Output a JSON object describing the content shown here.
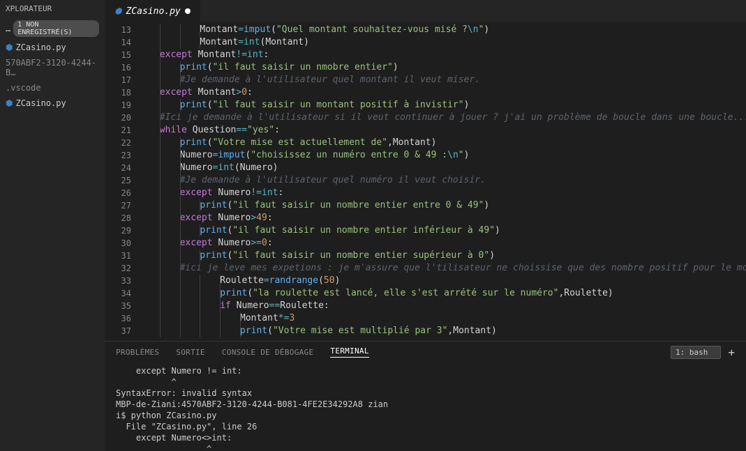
{
  "sidebar": {
    "header": "XPLORATEUR",
    "unsavedLabel": "1 NON ENREGISTRÉ(S)",
    "unsavedRow": "…",
    "items": [
      {
        "label": "ZCasino.py",
        "icon": "py"
      },
      {
        "label": "570ABF2-3120-4244-B…",
        "icon": ""
      },
      {
        "label": ".vscode",
        "icon": ""
      },
      {
        "label": "ZCasino.py",
        "icon": "py"
      }
    ]
  },
  "tab": {
    "file": "ZCasino.py"
  },
  "code": {
    "start": 13,
    "lines": [
      {
        "indent": 3,
        "html": "Montant<span class='op'>=</span><span class='fn'>imput</span>(<span class='str'>\"Quel montant souhaitez-vous misé ?<span class='esc'>\\n</span>\"</span>)"
      },
      {
        "indent": 3,
        "html": "Montant<span class='op'>=</span><span class='builtin'>int</span>(Montant)"
      },
      {
        "indent": 1,
        "html": "<span class='kw'>except</span> Montant<span class='op'>!=</span><span class='builtin'>int</span>:"
      },
      {
        "indent": 2,
        "html": "<span class='fn'>print</span>(<span class='str'>\"il faut saisir un nmobre entier\"</span>)"
      },
      {
        "indent": 2,
        "html": "<span class='com'>#Je demande à l'utilisateur quel montant il veut miser.</span>"
      },
      {
        "indent": 1,
        "html": "<span class='kw'>except</span> Montant<span class='op'>&gt;</span><span class='num'>0</span>:"
      },
      {
        "indent": 2,
        "html": "<span class='fn'>print</span>(<span class='str'>\"il faut saisir un montant positif à invistir\"</span>)"
      },
      {
        "indent": 1,
        "html": "<span class='com'>#Ici je demande à l'utilisateur si il veut continuer à jouer ? j'ai un problème de boucle dans une boucle... les \"conti</span>"
      },
      {
        "indent": 1,
        "html": "<span class='kw'>while</span> Question<span class='op'>==</span><span class='str'>\"yes\"</span>:"
      },
      {
        "indent": 2,
        "html": "<span class='fn'>print</span>(<span class='str'>\"Votre mise est actuellement de\"</span>,Montant)"
      },
      {
        "indent": 2,
        "html": "Numero<span class='op'>=</span><span class='fn'>imput</span>(<span class='str'>\"choisissez un numéro entre 0 &amp; 49 :<span class='esc'>\\n</span>\"</span>)"
      },
      {
        "indent": 2,
        "html": "Numero<span class='op'>=</span><span class='builtin'>int</span>(Numero)"
      },
      {
        "indent": 2,
        "html": "<span class='com'>#Je demande à l'utilisateur quel numéro il veut choisir.</span>"
      },
      {
        "indent": 2,
        "html": "<span class='kw'>except</span> Numero<span class='op'>!=</span><span class='builtin'>int</span>:"
      },
      {
        "indent": 3,
        "html": "<span class='fn'>print</span>(<span class='str'>\"il faut saisir un nombre entier entre 0 &amp; 49\"</span>)"
      },
      {
        "indent": 2,
        "html": "<span class='kw'>except</span> Numero<span class='op'>&gt;</span><span class='num'>49</span>:"
      },
      {
        "indent": 3,
        "html": "<span class='fn'>print</span>(<span class='str'>\"il faut saisir un nombre entier inférieur à 49\"</span>)"
      },
      {
        "indent": 2,
        "html": "<span class='kw'>except</span> Numero<span class='op'>&gt;=</span><span class='num'>0</span>:"
      },
      {
        "indent": 3,
        "html": "<span class='fn'>print</span>(<span class='str'>\"il faut saisir un nombre entier supérieur à 0\"</span>)"
      },
      {
        "indent": 2,
        "html": "<span class='com'>#ici je leve mes expetions : je m'assure que l'tilisateur ne choissise que des nombre positif pour le montant inves</span>"
      },
      {
        "indent": 4,
        "html": "Roulette<span class='op'>=</span><span class='fn'>randrange</span>(<span class='num'>50</span>)"
      },
      {
        "indent": 4,
        "html": "<span class='fn'>print</span>(<span class='str'>\"la roulette est lancé, elle s'est arrété sur le numéro\"</span>,Roulette)"
      },
      {
        "indent": 4,
        "html": "<span class='kw'>if</span> Numero<span class='op'>==</span>Roulette:"
      },
      {
        "indent": 5,
        "html": "Montant<span class='op'>*=</span><span class='num'>3</span>"
      },
      {
        "indent": 5,
        "html": "<span class='fn'>print</span>(<span class='str'>\"Votre mise est multiplié par 3\"</span>,Montant)"
      }
    ]
  },
  "panel": {
    "tabs": [
      "PROBLÈMES",
      "SORTIE",
      "CONSOLE DE DÉBOGAGE",
      "TERMINAL"
    ],
    "active": 3,
    "selector": "1: bash",
    "terminal": "    except Numero != int:\n           ^\nSyntaxError: invalid syntax\nMBP-de-Ziani:4570ABF2-3120-4244-B081-4FE2E34292A8 zian\ni$ python ZCasino.py\n  File \"ZCasino.py\", line 26\n    except Numero<>int:\n                  ^"
  }
}
